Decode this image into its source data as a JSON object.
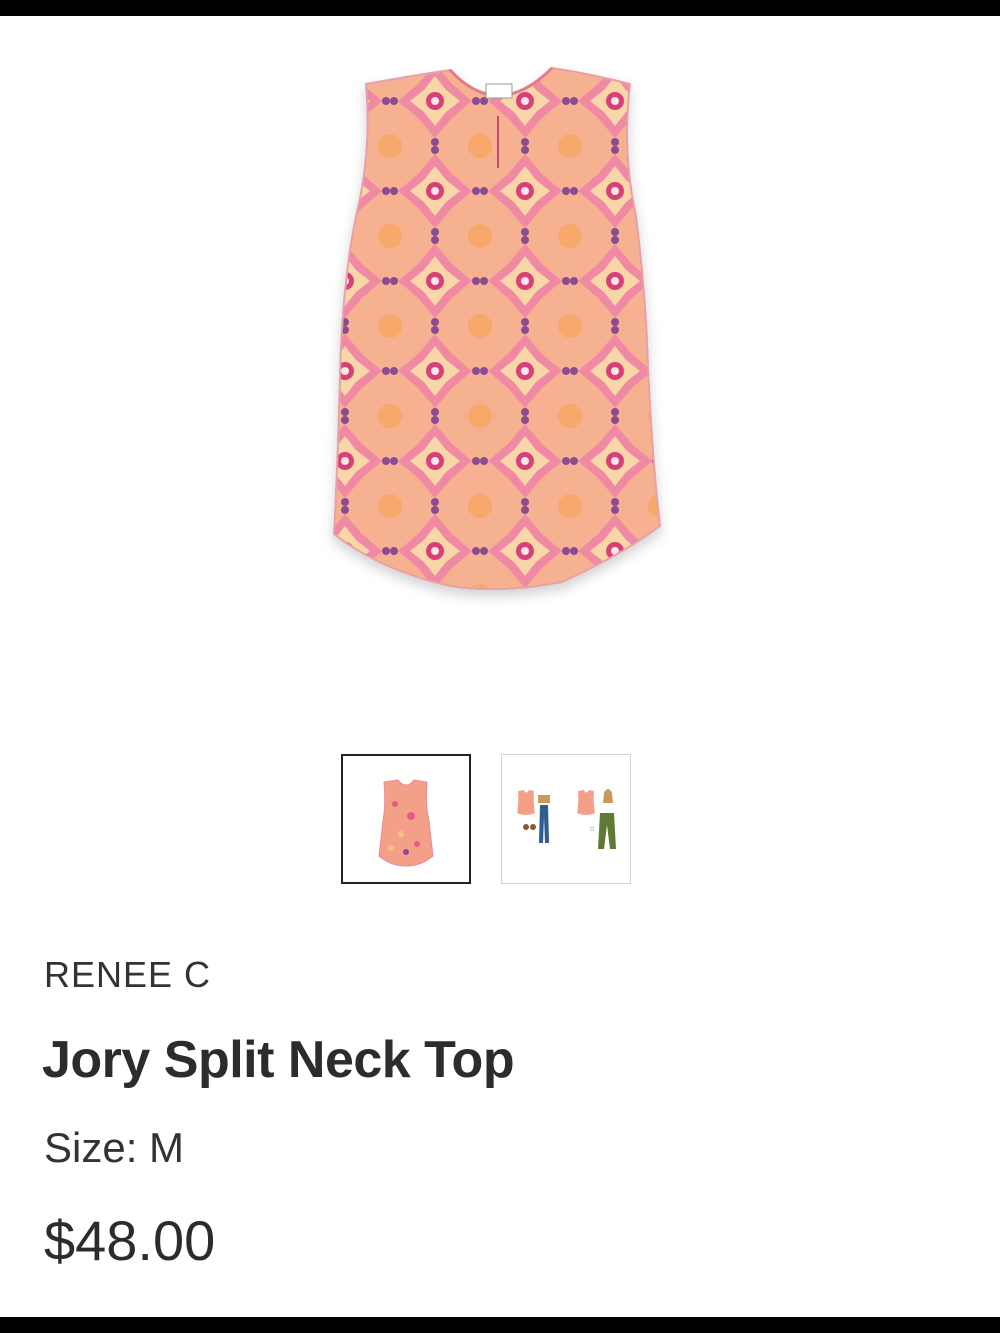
{
  "product": {
    "brand": "RENEE C",
    "name": "Jory Split Neck Top",
    "size_label": "Size: M",
    "price": "$48.00"
  },
  "gallery": {
    "hero_image": "product-top-image",
    "thumbnails": [
      {
        "name": "product-thumbnail",
        "selected": true
      },
      {
        "name": "outfit-thumbnail",
        "selected": false
      }
    ]
  },
  "colors": {
    "text_primary": "#2c2c2c",
    "text_secondary": "#333333",
    "selected_border": "#222222",
    "thumb_border": "#d3d3d3",
    "print_pink": "#f08aa4",
    "print_orange": "#f7a86a",
    "print_magenta": "#d9407a"
  }
}
